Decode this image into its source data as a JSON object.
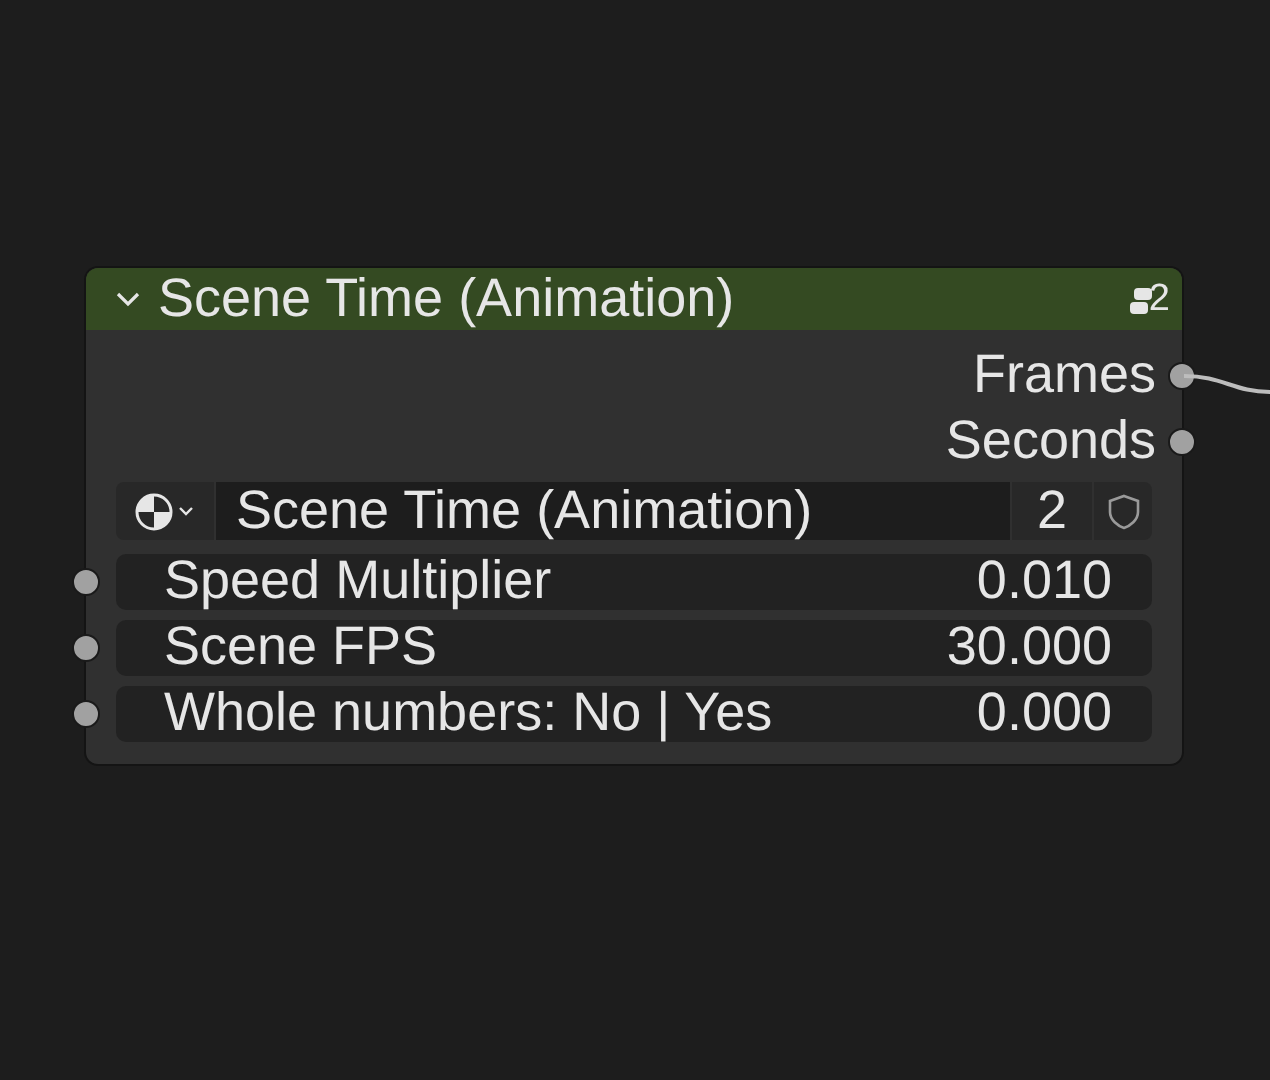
{
  "node": {
    "title": "Scene Time (Animation)",
    "expanded": true,
    "header_badge": "2",
    "outputs": [
      {
        "label": "Frames",
        "linked": true
      },
      {
        "label": "Seconds",
        "linked": false
      }
    ],
    "datablock": {
      "name": "Scene Time (Animation)",
      "users": "2",
      "fake_user": false
    },
    "inputs": [
      {
        "label": "Speed Multiplier",
        "value": "0.010"
      },
      {
        "label": "Scene FPS",
        "value": "30.000"
      },
      {
        "label": "Whole numbers: No | Yes",
        "value": "0.000"
      }
    ]
  }
}
